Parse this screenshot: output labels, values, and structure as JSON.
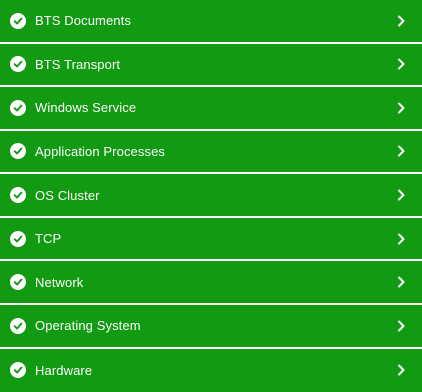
{
  "colors": {
    "row_background": "#129a12",
    "text": "#ffffff",
    "separator": "#ffffff"
  },
  "items": [
    {
      "label": "BTS Documents",
      "status_icon": "check-circle-icon",
      "action_icon": "chevron-right-icon"
    },
    {
      "label": "BTS Transport",
      "status_icon": "check-circle-icon",
      "action_icon": "chevron-right-icon"
    },
    {
      "label": "Windows Service",
      "status_icon": "check-circle-icon",
      "action_icon": "chevron-right-icon"
    },
    {
      "label": "Application Processes",
      "status_icon": "check-circle-icon",
      "action_icon": "chevron-right-icon"
    },
    {
      "label": "OS Cluster",
      "status_icon": "check-circle-icon",
      "action_icon": "chevron-right-icon"
    },
    {
      "label": "TCP",
      "status_icon": "check-circle-icon",
      "action_icon": "chevron-right-icon"
    },
    {
      "label": "Network",
      "status_icon": "check-circle-icon",
      "action_icon": "chevron-right-icon"
    },
    {
      "label": "Operating System",
      "status_icon": "check-circle-icon",
      "action_icon": "chevron-right-icon"
    },
    {
      "label": "Hardware",
      "status_icon": "check-circle-icon",
      "action_icon": "chevron-right-icon"
    }
  ]
}
